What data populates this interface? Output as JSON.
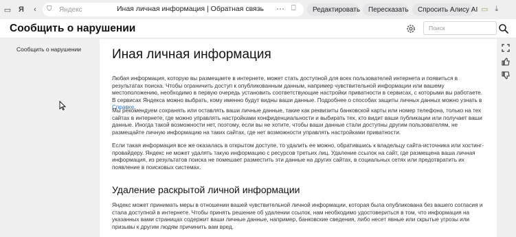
{
  "browser": {
    "address_host": "Яндекс",
    "tab_title": "Иная личная информация | Обратная связь",
    "edit_label": "Редактировать",
    "retell_label": "Пересказать",
    "alice_label": "Спросить Алису AI"
  },
  "header": {
    "title": "Сообщить о нарушении",
    "search_placeholder": "Поиск"
  },
  "sidebar": {
    "items": [
      {
        "label": "Сообщить о нарушении"
      }
    ]
  },
  "article": {
    "title": "Иная личная информация",
    "p1_text": "Любая информация, которую вы размещаете в интернете, может стать доступной для всех пользователей интернета и появиться в результатах поиска. Чтобы ограничить доступ к опубликованным данным, например чувствительной информации или вашему местоположению, необходимо в первую очередь установить соответствующие настройки приватности в сервисах, с которыми вы работаете. В сервисах Яндекса можно выбрать, кому именно будут видны ваши данные. Подробнее о способах защиты личных данных можно узнать в ",
    "p1_link": "Справке",
    "p1_end": ".",
    "p2": "Мы рекомендуем сохранять или оставлять ваши личные данные, такие как реквизиты банковской карты или номер телефона, только на тех сайтах в интернете, где можно управлять настройками конфиденциальности и выбирать тех, кто видит ваши публикации или получает ваши данные. Иногда такой возможности нет, поэтому, если вы не хотите, чтобы ваши данные стали доступны другим пользователям, не размещайте личную информацию на таких сайтах, где нет возможности управлять настройками приватности.",
    "p3": "Если такая информация все же оказалась в открытом доступе, то удалить ее можно, обратившись к владельцу сайта-источника или хостинг-провайдеру. Яндекс не может удалять такую информацию с ресурсов третьих лиц. Удаление ссылок на сайт, где размещена ваша личная информация, из результатов поиска не помешает разместить эти данные на других сайтах, в социальных сетях или предотвратить их появление в поисковых системах.",
    "h2": "Удаление раскрытой личной информации",
    "p4": "Яндекс может принимать меры в отношении вашей чувствительной личной информации, которая была опубликована без вашего согласия и стала доступной в интернете. Чтобы принять решение об удалении ссылок, нам необходимо удостовериться в том, что информация на указанных вами страницах содержит ваши личные данные, например, банковские сведения, либо несет явные или скрытые угрозы или призывы к другим людям причинить вам вред."
  },
  "colors": {
    "link": "#2a6fc9",
    "alice_gradient_start": "#7c3aed",
    "alice_gradient_end": "#ec4899"
  }
}
